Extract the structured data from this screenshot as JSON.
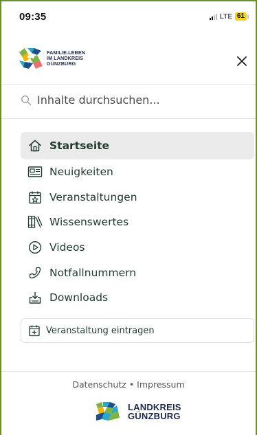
{
  "status_bar": {
    "time": "09:35",
    "network": "LTE",
    "battery": "61"
  },
  "header": {
    "logo_lines": [
      "FAMILIE.LEBEN",
      "IM LANDKREIS",
      "GÜNZBURG"
    ],
    "close_icon": "close-icon"
  },
  "search": {
    "placeholder": "Inhalte durchsuchen...",
    "icon": "search-icon"
  },
  "nav": {
    "items": [
      {
        "label": "Startseite",
        "icon": "home-icon",
        "active": true
      },
      {
        "label": "Neuigkeiten",
        "icon": "newspaper-icon",
        "active": false
      },
      {
        "label": "Veranstaltungen",
        "icon": "calendar-star-icon",
        "active": false
      },
      {
        "label": "Wissenswertes",
        "icon": "books-icon",
        "active": false
      },
      {
        "label": "Videos",
        "icon": "play-circle-icon",
        "active": false
      },
      {
        "label": "Notfallnummern",
        "icon": "phone-icon",
        "active": false
      },
      {
        "label": "Downloads",
        "icon": "download-icon",
        "active": false
      }
    ]
  },
  "cta": {
    "label": "Veranstaltung eintragen",
    "icon": "calendar-plus-icon"
  },
  "footer": {
    "privacy": "Datenschutz",
    "separator": "•",
    "imprint": "Impressum",
    "logo_lines": [
      "LANDKREIS",
      "GÜNZBURG"
    ]
  },
  "colors": {
    "frame": "#6a8f2f",
    "active_bg": "#ebebeb",
    "nav_text": "#1f3a2e",
    "battery": "#f2d21c"
  }
}
